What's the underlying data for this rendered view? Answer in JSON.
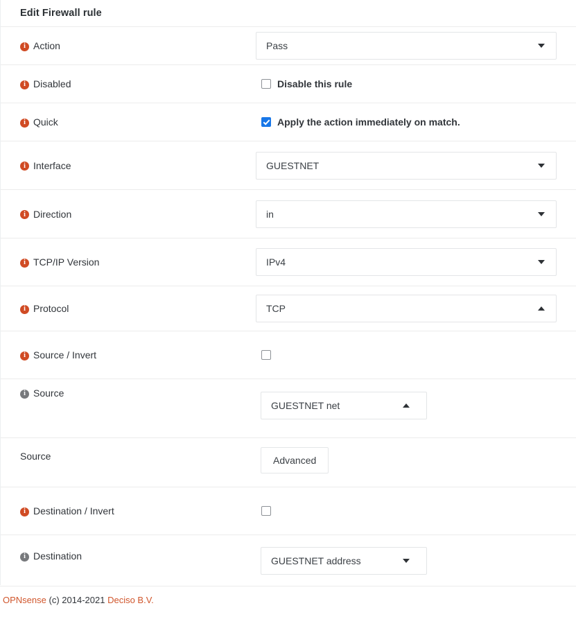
{
  "header": {
    "title": "Edit Firewall rule"
  },
  "rows": [
    {
      "label": "Action",
      "icon": "info-icon",
      "icon_color": "orange",
      "control": "select",
      "value": "Pass",
      "caret": "down"
    },
    {
      "label": "Disabled",
      "icon": "info-icon",
      "icon_color": "orange",
      "control": "checkbox",
      "checked": false,
      "checkbox_label": "Disable this rule"
    },
    {
      "label": "Quick",
      "icon": "info-icon",
      "icon_color": "orange",
      "control": "checkbox",
      "checked": true,
      "checkbox_label": "Apply the action immediately on match."
    },
    {
      "label": "Interface",
      "icon": "info-icon",
      "icon_color": "orange",
      "control": "select",
      "value": "GUESTNET",
      "caret": "down"
    },
    {
      "label": "Direction",
      "icon": "info-icon",
      "icon_color": "orange",
      "control": "select",
      "value": "in",
      "caret": "down"
    },
    {
      "label": "TCP/IP Version",
      "icon": "info-icon",
      "icon_color": "orange",
      "control": "select",
      "value": "IPv4",
      "caret": "down"
    },
    {
      "label": "Protocol",
      "icon": "info-icon",
      "icon_color": "orange",
      "control": "select",
      "value": "TCP",
      "caret": "up"
    },
    {
      "label": "Source / Invert",
      "icon": "info-icon",
      "icon_color": "orange",
      "control": "checkbox",
      "checked": false,
      "checkbox_label": ""
    },
    {
      "label": "Source",
      "icon": "info-icon",
      "icon_color": "gray",
      "control": "select-narrow",
      "value": "GUESTNET net",
      "caret": "up"
    },
    {
      "label": "Source",
      "icon": "none",
      "icon_color": "",
      "control": "button",
      "value": "Advanced"
    },
    {
      "label": "Destination / Invert",
      "icon": "info-icon",
      "icon_color": "orange",
      "control": "checkbox",
      "checked": false,
      "checkbox_label": ""
    },
    {
      "label": "Destination",
      "icon": "info-icon",
      "icon_color": "gray",
      "control": "select-narrow",
      "value": "GUESTNET address",
      "caret": "down"
    }
  ],
  "footer": {
    "brand": "OPNsense",
    "copyright": "(c) 2014-2021",
    "company": "Deciso B.V.",
    "link_color": "#d0562c"
  }
}
